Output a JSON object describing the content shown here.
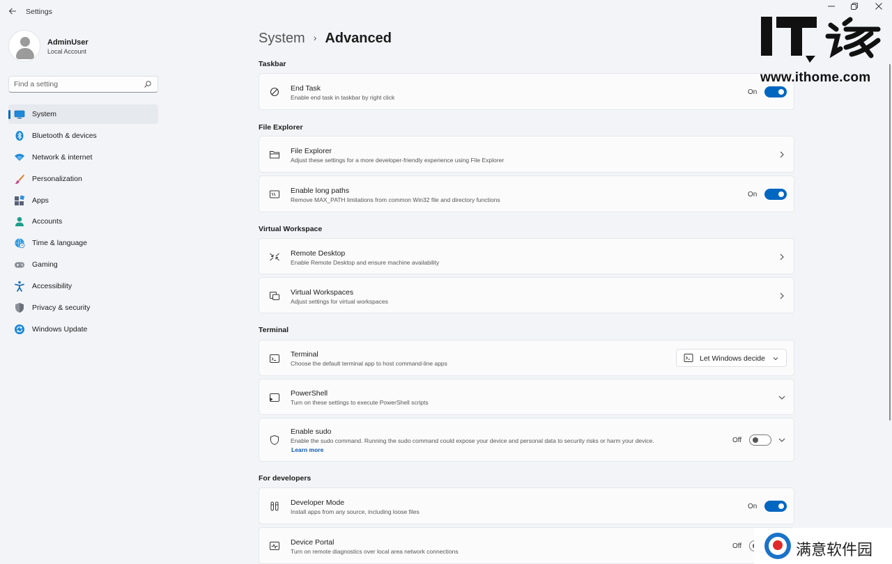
{
  "window": {
    "title": "Settings",
    "back_icon": "back-arrow-icon",
    "controls": [
      "minimize",
      "restore",
      "close"
    ]
  },
  "profile": {
    "name": "AdminUser",
    "account_type": "Local Account"
  },
  "search": {
    "placeholder": "Find a setting"
  },
  "sidebar": {
    "items": [
      {
        "label": "System",
        "icon": "monitor-icon",
        "selected": true
      },
      {
        "label": "Bluetooth & devices",
        "icon": "bluetooth-icon"
      },
      {
        "label": "Network & internet",
        "icon": "wifi-icon"
      },
      {
        "label": "Personalization",
        "icon": "brush-icon"
      },
      {
        "label": "Apps",
        "icon": "apps-icon"
      },
      {
        "label": "Accounts",
        "icon": "person-icon"
      },
      {
        "label": "Time & language",
        "icon": "globe-clock-icon"
      },
      {
        "label": "Gaming",
        "icon": "gamepad-icon"
      },
      {
        "label": "Accessibility",
        "icon": "accessibility-icon"
      },
      {
        "label": "Privacy & security",
        "icon": "shield-icon"
      },
      {
        "label": "Windows Update",
        "icon": "update-icon"
      }
    ]
  },
  "breadcrumb": {
    "parent": "System",
    "separator": "›",
    "current": "Advanced"
  },
  "sections": {
    "taskbar": "Taskbar",
    "file_explorer": "File Explorer",
    "virtual_workspace": "Virtual Workspace",
    "terminal": "Terminal",
    "for_developers": "For developers"
  },
  "cards": {
    "end_task": {
      "title": "End Task",
      "desc": "Enable end task in taskbar by right click",
      "state": "On"
    },
    "file_explorer": {
      "title": "File Explorer",
      "desc": "Adjust these settings for a more developer-friendly experience using File Explorer"
    },
    "long_paths": {
      "title": "Enable long paths",
      "desc": "Remove MAX_PATH limitations from common Win32 file and directory functions",
      "state": "On"
    },
    "remote_desktop": {
      "title": "Remote Desktop",
      "desc": "Enable Remote Desktop and ensure machine availability"
    },
    "virtual_workspaces": {
      "title": "Virtual Workspaces",
      "desc": "Adjust settings for virtual workspaces"
    },
    "terminal": {
      "title": "Terminal",
      "desc": "Choose the default terminal app to host command-line apps",
      "dropdown": "Let Windows decide"
    },
    "powershell": {
      "title": "PowerShell",
      "desc": "Turn on these settings to execute PowerShell scripts"
    },
    "sudo": {
      "title": "Enable sudo",
      "desc": "Enable the sudo command. Running the sudo command could expose your device and personal data to security risks or harm your device.",
      "link": "Learn more",
      "state": "Off"
    },
    "developer_mode": {
      "title": "Developer Mode",
      "desc": "Install apps from any source, including loose files",
      "state": "On"
    },
    "device_portal": {
      "title": "Device Portal",
      "desc": "Turn on remote diagnostics over local area network connections",
      "state": "Off"
    }
  },
  "watermarks": {
    "logo_text": "IT之家",
    "url": "www.ithome.com",
    "bottom": "满意软件园"
  },
  "colors": {
    "accent": "#0067c0",
    "background": "#f2f4f8",
    "card": "#fbfbfc"
  }
}
